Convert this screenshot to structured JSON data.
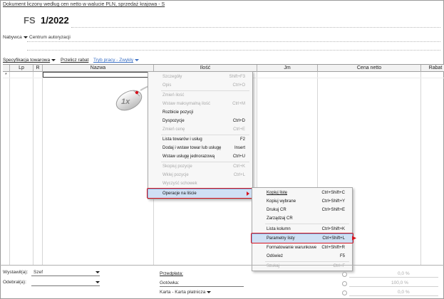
{
  "header": {
    "doc_title": "Dokument liczony według cen netto w walucie PLN, sprzedaż krajowa - S",
    "doc_type": "FS",
    "doc_number": "1/2022"
  },
  "buyer": {
    "label": "Nabywca",
    "value": "Centrum autoryzacji"
  },
  "toolbar": {
    "spec": "Specyfikacja towarowa",
    "recalc": "Przelicz rabat",
    "mode": "Tryb pracy - Zwykły"
  },
  "grid": {
    "columns": [
      "Lp",
      "R",
      "Nazwa",
      "Ilość",
      "Jm",
      "Cena netto",
      "Rabat"
    ],
    "new_row_marker": "*"
  },
  "context_menu": {
    "items": [
      {
        "label": "Szczegóły",
        "shortcut": "Shift+F3",
        "disabled": true
      },
      {
        "label": "Opis",
        "shortcut": "Ctrl+O",
        "disabled": true
      },
      {
        "label": "Zmień ilość",
        "shortcut": "",
        "disabled": true
      },
      {
        "label": "Wstaw maksymalną ilość",
        "shortcut": "Ctrl+M",
        "disabled": true
      },
      {
        "label": "Rozbicie pozycji",
        "shortcut": "",
        "disabled": false
      },
      {
        "label": "Dyspozycje",
        "shortcut": "Ctrl+D",
        "disabled": false
      },
      {
        "label": "Zmień cenę",
        "shortcut": "Ctrl+E",
        "disabled": true
      },
      {
        "label": "Lista towarów i usług",
        "shortcut": "F2",
        "disabled": false
      },
      {
        "label": "Dodaj i wstaw towar lub usługę",
        "shortcut": "Insert",
        "disabled": false
      },
      {
        "label": "Wstaw usługę jednorazową",
        "shortcut": "Ctrl+U",
        "disabled": false
      },
      {
        "label": "Skopiuj pozycje",
        "shortcut": "Ctrl+K",
        "disabled": true
      },
      {
        "label": "Wklej pozycje",
        "shortcut": "Ctrl+L",
        "disabled": true
      },
      {
        "label": "Wyczyść schowek",
        "shortcut": "",
        "disabled": true
      },
      {
        "label": "Operacje na liście",
        "shortcut": "",
        "disabled": false
      }
    ]
  },
  "submenu": {
    "items": [
      {
        "label": "Kopiuj listę",
        "shortcut": "Ctrl+Shift+C",
        "disabled": false
      },
      {
        "label": "Kopiuj wybrane",
        "shortcut": "Ctrl+Shift+Y",
        "disabled": false
      },
      {
        "label": "Drukuj CR",
        "shortcut": "Ctrl+Shift+E",
        "disabled": false
      },
      {
        "label": "Zarządzaj CR",
        "shortcut": "",
        "disabled": false
      },
      {
        "label": "Lista kolumn",
        "shortcut": "Ctrl+Shift+K",
        "disabled": false
      },
      {
        "label": "Parametry listy",
        "shortcut": "Ctrl+Shift+L",
        "disabled": false
      },
      {
        "label": "Formatowanie warunkowe",
        "shortcut": "Ctrl+Shift+R",
        "disabled": false
      },
      {
        "label": "Odśwież",
        "shortcut": "F5",
        "disabled": false
      },
      {
        "label": "Szukaj",
        "shortcut": "Ctrl+F",
        "disabled": true
      }
    ]
  },
  "mouse_hint": {
    "label": "1x"
  },
  "footer": {
    "issued_by_label": "Wystawił(a):",
    "issued_by_value": "Szef",
    "received_by_label": "Odebrał(a):",
    "prepayment_label": "Przedpłata:",
    "cash_label": "Gotówka:",
    "card_label": "Karta - Karta płatnicza",
    "pct1": "0,0 %",
    "pct2": "100,0 %",
    "pct3": "0,0 %"
  }
}
